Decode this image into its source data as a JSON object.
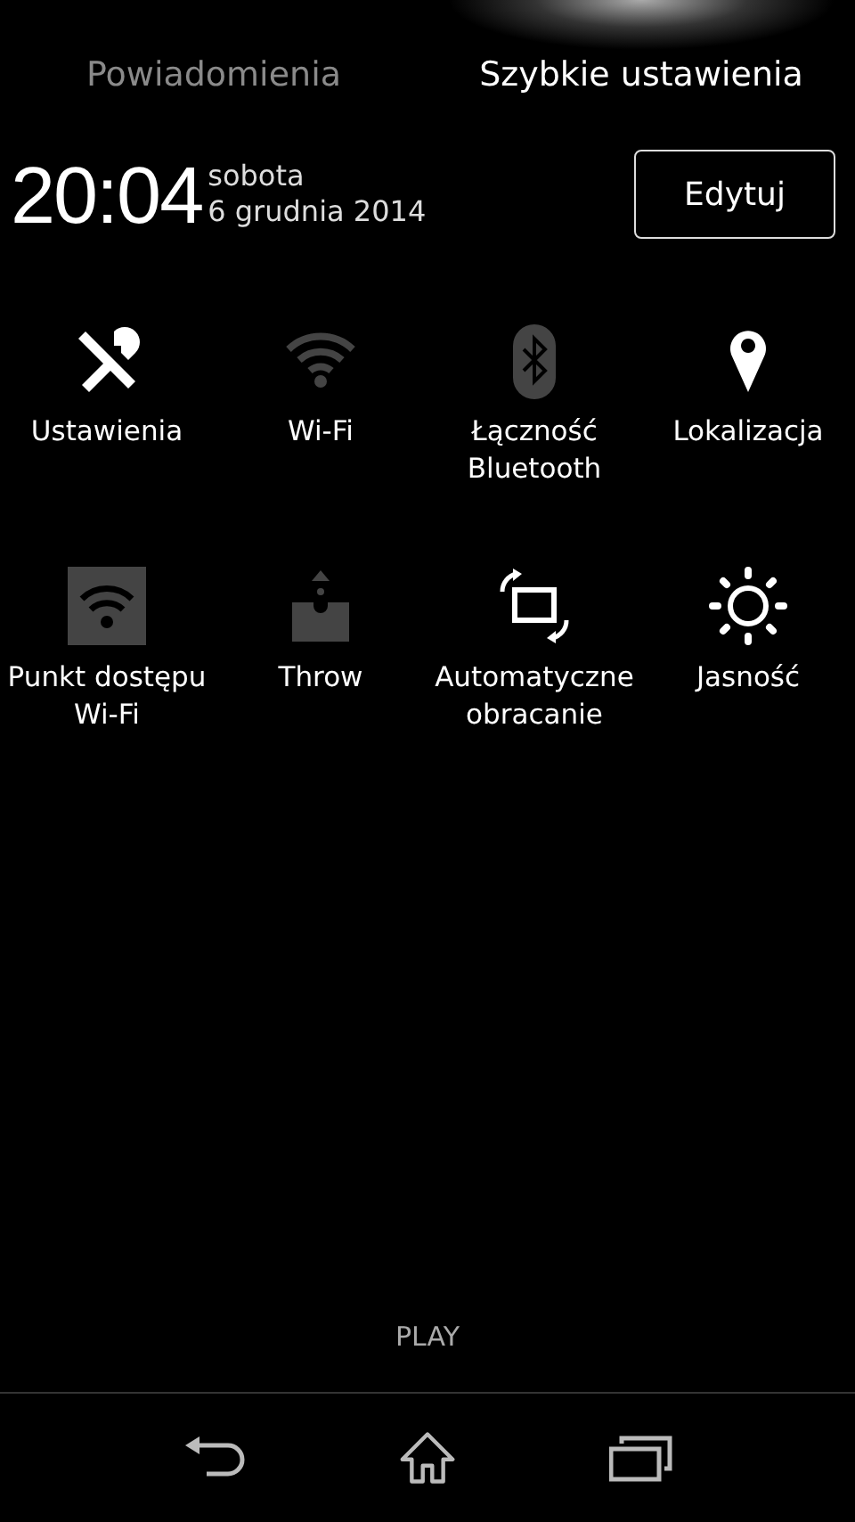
{
  "tabs": [
    {
      "label": "Powiadomienia",
      "selected": false
    },
    {
      "label": "Szybkie ustawienia",
      "selected": true
    }
  ],
  "clock": {
    "time": "20:04",
    "day": "sobota",
    "date": "6 grudnia 2014"
  },
  "edit_button": "Edytuj",
  "tiles": [
    {
      "kind": "settings",
      "label": "Ustawienia",
      "on": true
    },
    {
      "kind": "wifi",
      "label": "Wi-Fi",
      "on": false
    },
    {
      "kind": "bluetooth",
      "label": "Łączność Bluetooth",
      "on": false
    },
    {
      "kind": "location",
      "label": "Lokalizacja",
      "on": true
    },
    {
      "kind": "hotspot",
      "label": "Punkt dostępu Wi-Fi",
      "on": false
    },
    {
      "kind": "throw",
      "label": "Throw",
      "on": false
    },
    {
      "kind": "rotate",
      "label": "Automatyczne obracanie",
      "on": true
    },
    {
      "kind": "brightness",
      "label": "Jasność",
      "on": true
    }
  ],
  "carrier": "PLAY",
  "nav": [
    {
      "kind": "back"
    },
    {
      "kind": "home"
    },
    {
      "kind": "recents"
    }
  ]
}
